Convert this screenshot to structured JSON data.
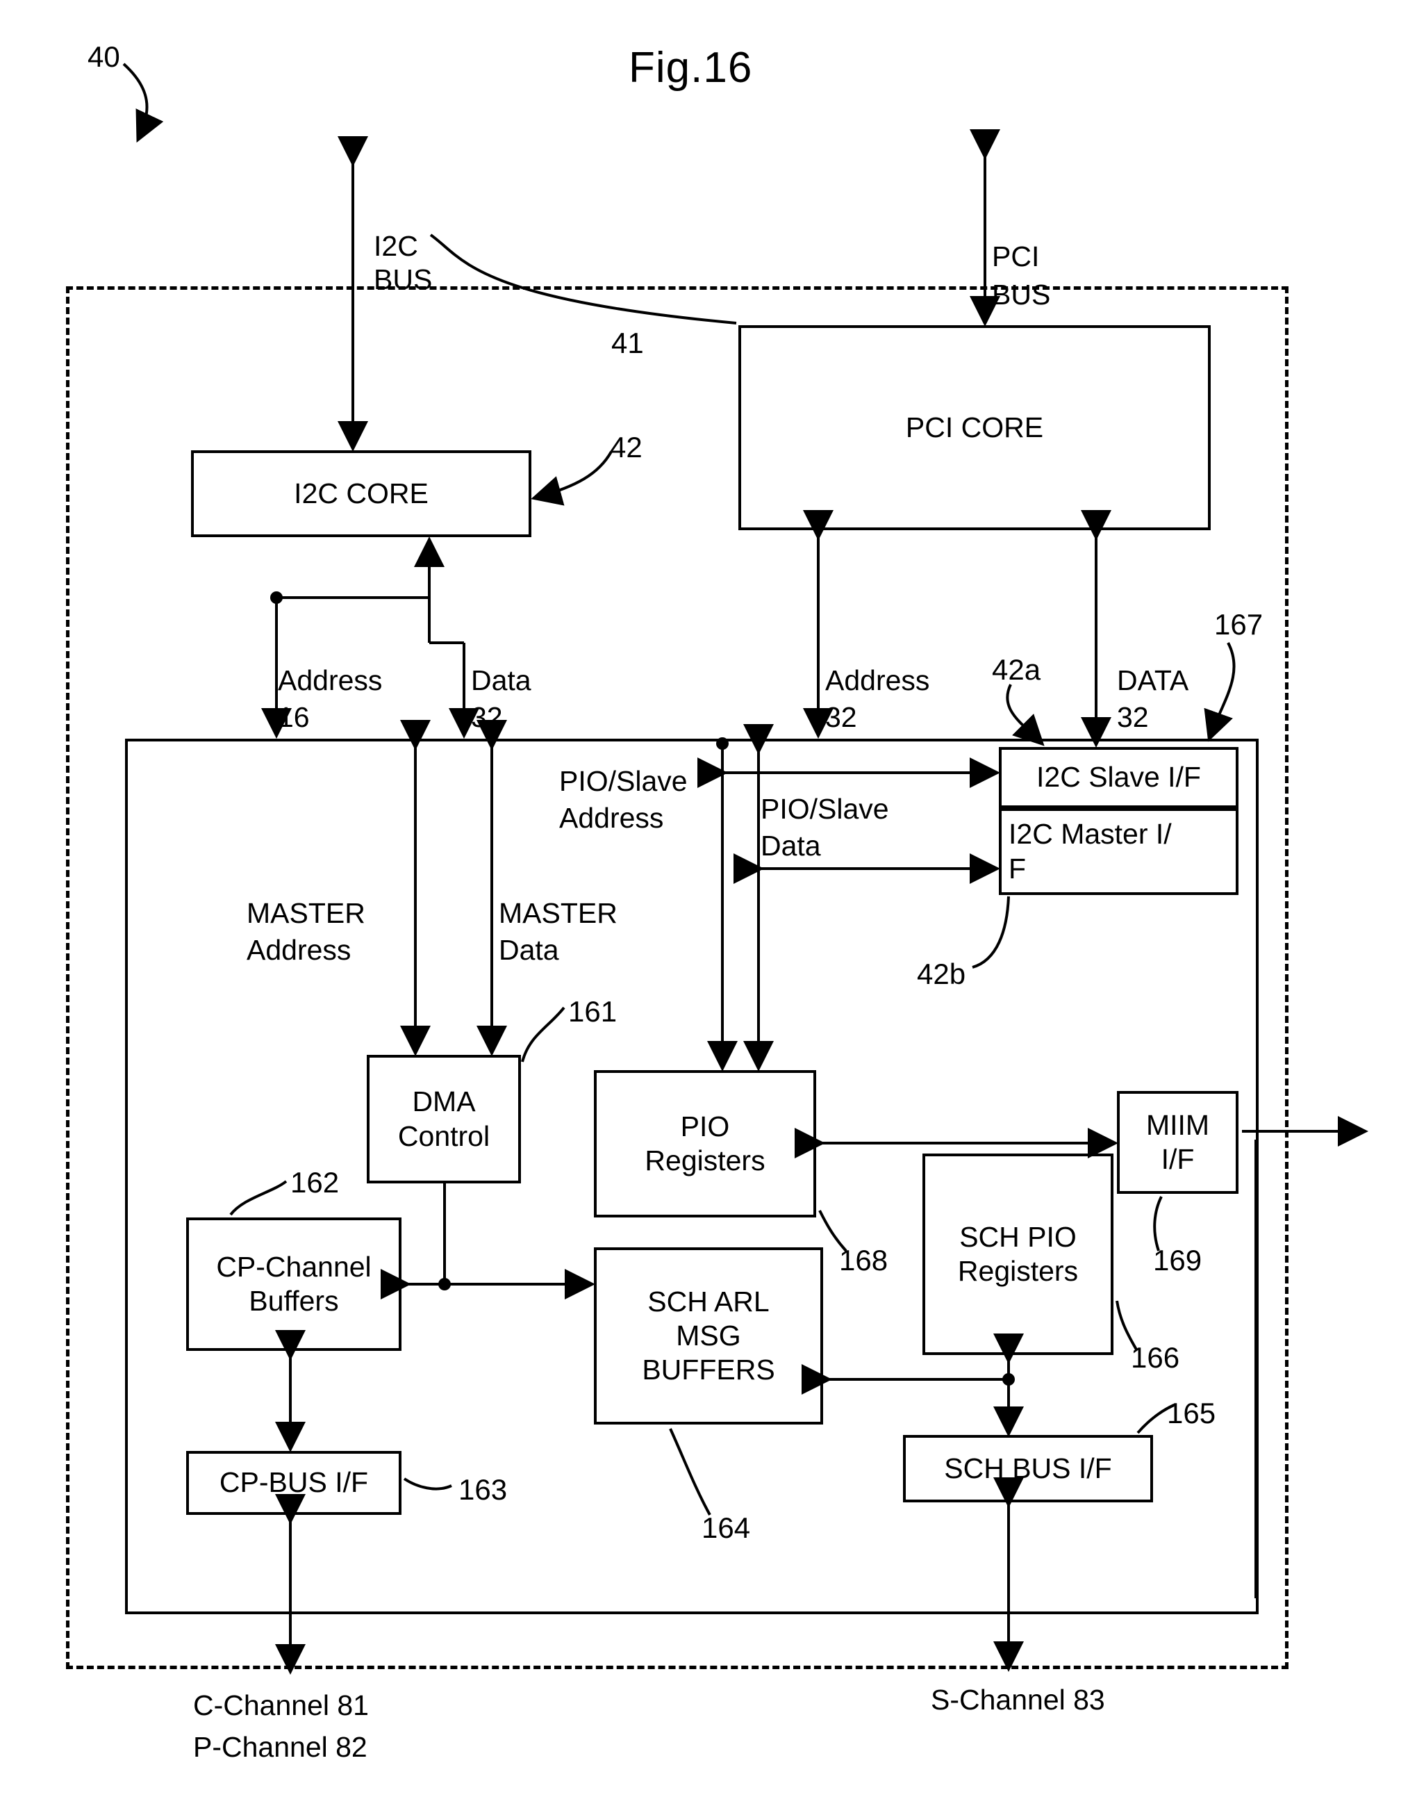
{
  "figure": {
    "title": "Fig.16",
    "root_ref": "40"
  },
  "external_buses": {
    "i2c_bus": "I2C\nBUS",
    "i2c_bus_line1": "I2C",
    "i2c_bus_line2": "BUS",
    "pci_bus_line1": "PCI",
    "pci_bus_line2": "BUS"
  },
  "blocks": {
    "i2c_core": {
      "label": "I2C CORE",
      "ref": "42"
    },
    "pci_core": {
      "label": "PCI CORE",
      "ref": "41"
    },
    "i2c_slave_if": {
      "label": "I2C Slave I/F",
      "ref": "42a"
    },
    "i2c_master_if": {
      "label": "I2C Master I/\nF",
      "line1": "I2C Master I/",
      "line2": "F",
      "ref": "42b"
    },
    "dma_control": {
      "line1": "DMA",
      "line2": "Control",
      "ref": "161"
    },
    "pio_registers": {
      "line1": "PIO",
      "line2": "Registers",
      "ref": "168"
    },
    "cp_channel_buffers": {
      "line1": "CP-Channel",
      "line2": "Buffers",
      "ref": "162"
    },
    "cp_bus_if": {
      "label": "CP-BUS I/F",
      "ref": "163"
    },
    "sch_arl_msg_buffers": {
      "line1": "SCH ARL",
      "line2": "MSG",
      "line3": "BUFFERS",
      "ref": "164"
    },
    "sch_pio_registers": {
      "line1": "SCH PIO",
      "line2": "Registers",
      "ref": "166"
    },
    "sch_bus_if": {
      "label": "SCH BUS I/F",
      "ref": "165"
    },
    "miim_if": {
      "line1": "MIIM",
      "line2": "I/F",
      "ref": "169"
    },
    "inner_region": {
      "ref": "167"
    }
  },
  "signal_labels": {
    "i2c_address": {
      "name": "Address",
      "width": "16"
    },
    "i2c_data": {
      "name": "Data",
      "width": "32"
    },
    "pci_address": {
      "name": "Address",
      "width": "32"
    },
    "pci_data": {
      "name": "DATA",
      "width": "32"
    },
    "pio_slave_address_l1": "PIO/Slave",
    "pio_slave_address_l2": "Address",
    "pio_slave_data_l1": "PIO/Slave",
    "pio_slave_data_l2": "Data",
    "master_address_l1": "MASTER",
    "master_address_l2": "Address",
    "master_data_l1": "MASTER",
    "master_data_l2": "Data"
  },
  "bottom_labels": {
    "c_channel": "C-Channel 81",
    "p_channel": "P-Channel 82",
    "s_channel": "S-Channel 83"
  },
  "colors": {
    "ink": "#000000",
    "paper": "#ffffff"
  }
}
